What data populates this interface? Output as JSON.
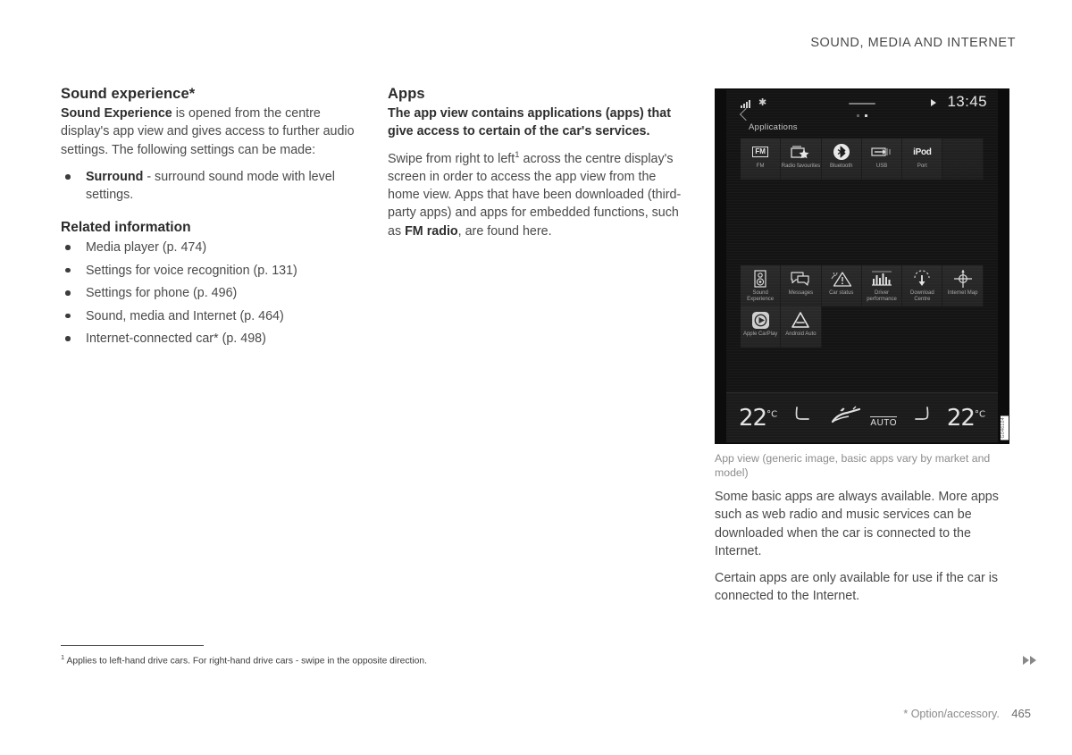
{
  "header": {
    "title": "SOUND, MEDIA AND INTERNET"
  },
  "left_column": {
    "section_title": "Sound experience*",
    "intro_bold": "Sound Experience",
    "intro_rest": " is opened from the centre display's app view and gives access to further audio settings. The following settings can be made:",
    "bullets": [
      {
        "bold": "Surround",
        "rest": " - surround sound mode with level settings."
      }
    ],
    "related_title": "Related information",
    "related": [
      "Media player (p. 474)",
      "Settings for voice recognition (p. 131)",
      "Settings for phone (p. 496)",
      "Sound, media and Internet (p. 464)",
      "Internet-connected car* (p. 498)"
    ]
  },
  "middle_column": {
    "section_title": "Apps",
    "lead": "The app view contains applications (apps) that give access to certain of the car's services.",
    "para_a": "Swipe from right to left",
    "footnote_marker": "1",
    "para_b": " across the centre display's screen in order to access the app view from the home view. Apps that have been downloaded (third-party apps) and apps for embedded functions, such as ",
    "para_bold": "FM radio",
    "para_c": ", are found here."
  },
  "centre_display": {
    "status": {
      "signal_icon": "signal-bars-icon",
      "bluetooth_icon": "bluetooth-icon",
      "bluetooth_glyph": "✱",
      "play_icon": "play-icon",
      "clock": "13:45"
    },
    "back_icon": "chevron-left-icon",
    "page_dots": [
      false,
      true
    ],
    "page_title": "Applications",
    "apps_row1": [
      {
        "label": "FM",
        "icon": "fm-radio-icon"
      },
      {
        "label": "Radio favourites",
        "icon": "radio-favourites-icon"
      },
      {
        "label": "Bluetooth",
        "icon": "bluetooth-icon"
      },
      {
        "label": "USB",
        "icon": "usb-icon"
      },
      {
        "label": "Port",
        "icon": "ipod-icon",
        "glyph": "iPod"
      },
      {
        "label": "",
        "icon": "empty-tile"
      }
    ],
    "apps_row2": [
      {
        "label": "Sound Experience",
        "icon": "speaker-icon"
      },
      {
        "label": "Messages",
        "icon": "messages-icon"
      },
      {
        "label": "Car status",
        "icon": "car-status-warning-icon"
      },
      {
        "label": "Driver performance",
        "icon": "driver-performance-icon"
      },
      {
        "label": "Download Centre",
        "icon": "download-centre-icon"
      },
      {
        "label": "Internet Map",
        "icon": "internet-map-icon"
      }
    ],
    "apps_row3": [
      {
        "label": "Apple CarPlay",
        "icon": "apple-carplay-icon"
      },
      {
        "label": "Android Auto",
        "icon": "android-auto-icon"
      }
    ],
    "climate": {
      "left_temp": "22",
      "left_unit": "°C",
      "right_temp": "22",
      "right_unit": "°C",
      "left_seat_icon": "seat-heater-left-icon",
      "right_seat_icon": "seat-heater-right-icon",
      "auto_icon": "airflow-auto-icon",
      "auto_label": "AUTO"
    },
    "watermark": "G046104"
  },
  "figure": {
    "caption": "App view (generic image, basic apps vary by market and model)"
  },
  "right_column": {
    "para1": "Some basic apps are always available. More apps such as web radio and music services can be downloaded when the car is connected to the Internet.",
    "para2": "Certain apps are only available for use if the car is connected to the Internet."
  },
  "footnote": {
    "marker": "1",
    "text": "Applies to left-hand drive cars. For right-hand drive cars - swipe in the opposite direction."
  },
  "footer": {
    "option_note": "* Option/accessory.",
    "page_number": "465",
    "forward_icon": "double-chevron-right-icon"
  }
}
